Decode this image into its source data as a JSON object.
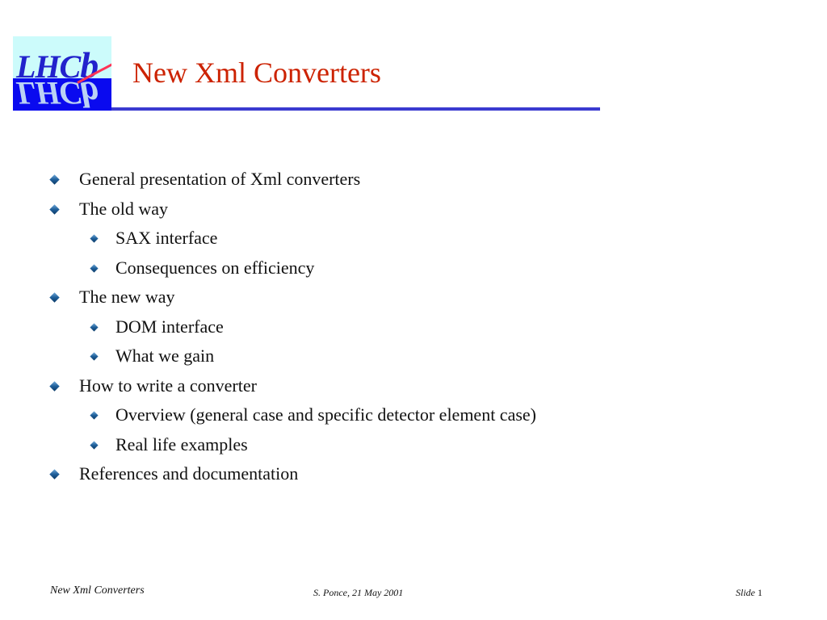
{
  "logo": {
    "text_main": "LHC",
    "text_b": "b",
    "label": "LHCb logo"
  },
  "title": "New Xml Converters",
  "bullets": [
    {
      "level": 1,
      "text": "General presentation of Xml converters"
    },
    {
      "level": 1,
      "text": "The old way"
    },
    {
      "level": 2,
      "text": "SAX interface"
    },
    {
      "level": 2,
      "text": "Consequences on efficiency"
    },
    {
      "level": 1,
      "text": "The new way"
    },
    {
      "level": 2,
      "text": "DOM interface"
    },
    {
      "level": 2,
      "text": "What we gain"
    },
    {
      "level": 1,
      "text": "How to write a converter"
    },
    {
      "level": 2,
      "text": "Overview (general case and specific detector element case)"
    },
    {
      "level": 2,
      "text": "Real life examples"
    },
    {
      "level": 1,
      "text": "References and documentation"
    }
  ],
  "footer": {
    "left": "New Xml Converters",
    "middle": "S. Ponce,  21 May 2001",
    "slide_label": "Slide",
    "slide_number": "1"
  },
  "colors": {
    "title": "#cc2200",
    "rule": "#3a3ad0",
    "logo_top": "#ccfbfb",
    "logo_bottom": "#0a0aef"
  }
}
